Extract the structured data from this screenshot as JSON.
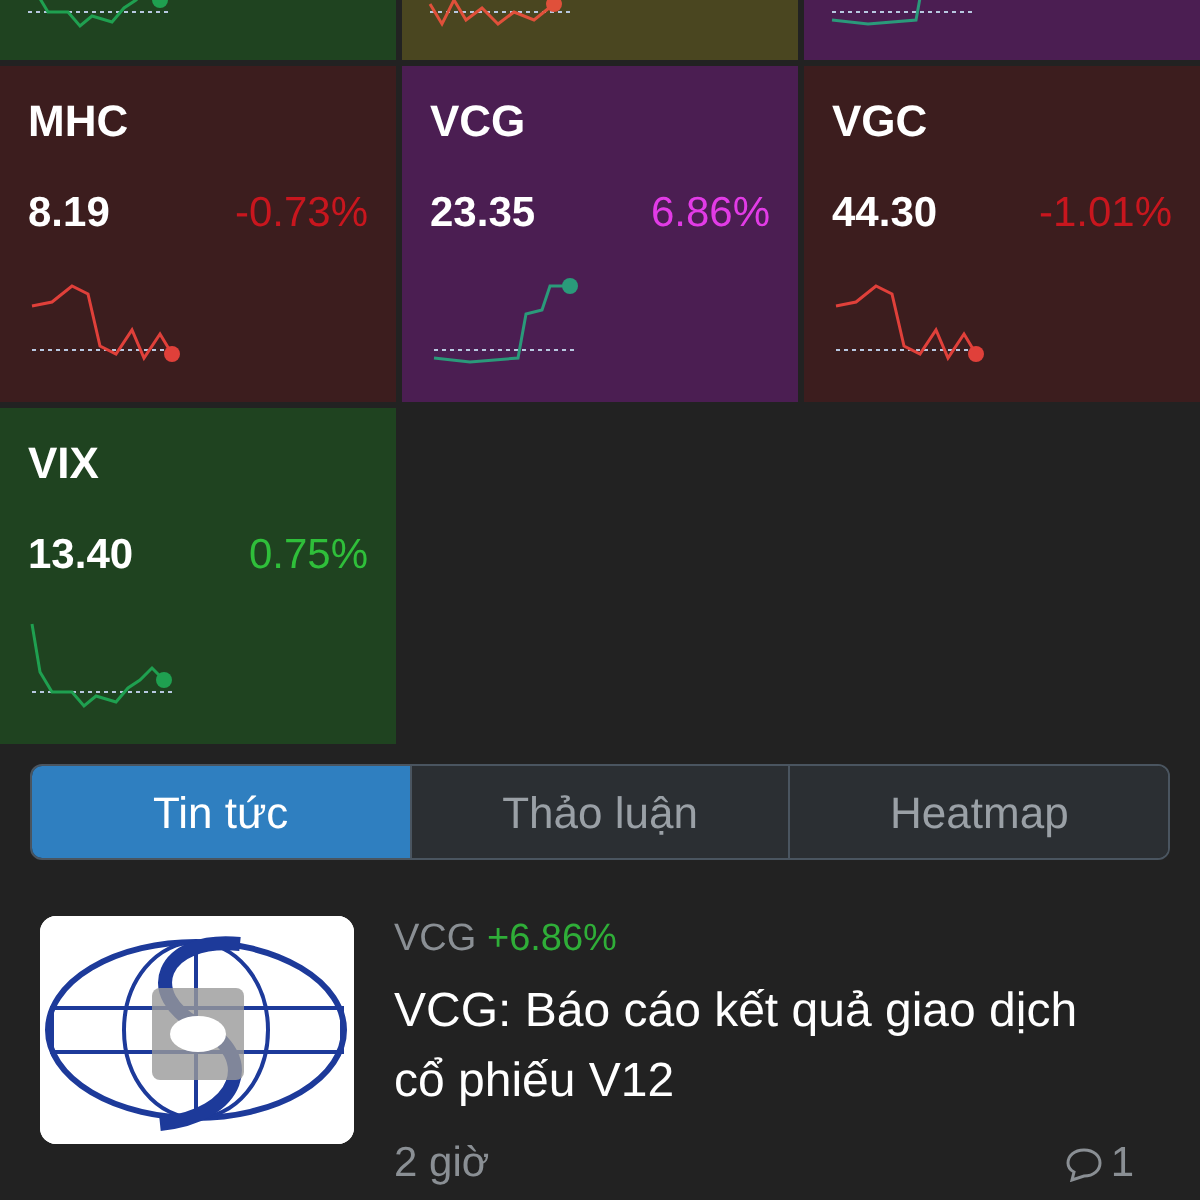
{
  "top_tiles": [
    {
      "kind": "up"
    },
    {
      "kind": "reference"
    },
    {
      "kind": "ceiling"
    }
  ],
  "tiles": [
    {
      "symbol": "MHC",
      "price": "8.19",
      "change": "-0.73%",
      "kind": "down"
    },
    {
      "symbol": "VCG",
      "price": "23.35",
      "change": "6.86%",
      "kind": "ceiling"
    },
    {
      "symbol": "VGC",
      "price": "44.30",
      "change": "-1.01%",
      "kind": "down"
    },
    {
      "symbol": "VIX",
      "price": "13.40",
      "change": "0.75%",
      "kind": "up"
    }
  ],
  "tabs": [
    {
      "label": "Tin tức",
      "selected": true
    },
    {
      "label": "Thảo luận",
      "selected": false
    },
    {
      "label": "Heatmap",
      "selected": false
    }
  ],
  "news": [
    {
      "symbol": "VCG",
      "change": "+6.86%",
      "title": "VCG: Báo cáo kết quả giao dịch cổ phiếu V12",
      "time": "2 giờ",
      "comments": "1"
    }
  ]
}
